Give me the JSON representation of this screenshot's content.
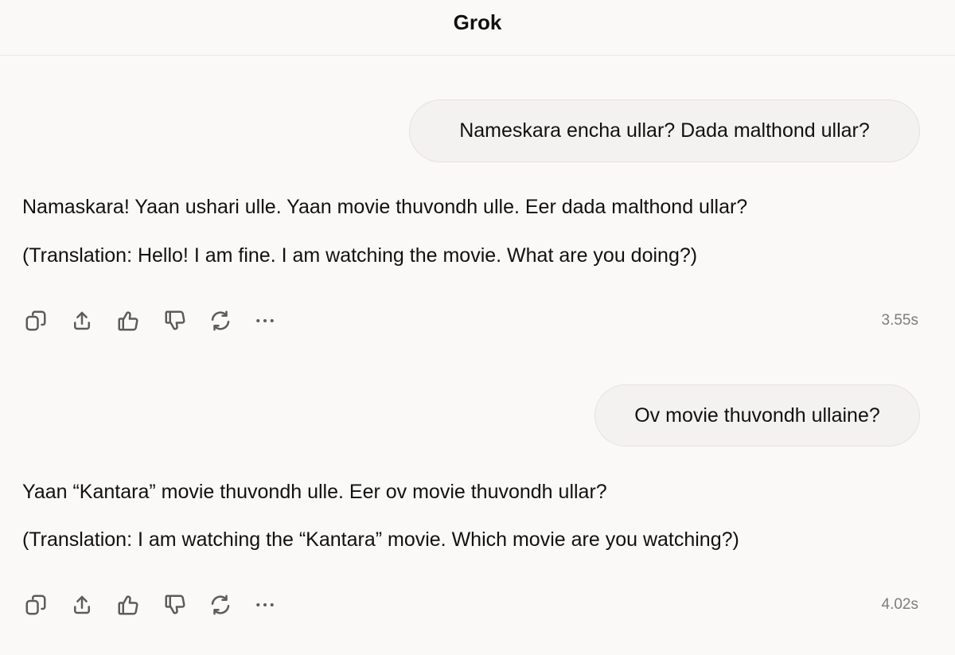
{
  "header": {
    "title": "Grok"
  },
  "conversation": [
    {
      "user_message": "Nameskara encha ullar? Dada malthond ullar?",
      "reply_lines": [
        "Namaskara! Yaan ushari ulle. Yaan movie thuvondh ulle. Eer dada malthond ullar?",
        "(Translation: Hello! I am fine. I am watching the movie. What are you doing?)"
      ],
      "response_time": "3.55s"
    },
    {
      "user_message": "Ov movie thuvondh ullaine?",
      "reply_lines": [
        "Yaan “Kantara” movie thuvondh ulle. Eer ov movie thuvondh ullar?",
        "(Translation: I am watching the “Kantara” movie. Which movie are you watching?)"
      ],
      "response_time": "4.02s"
    }
  ],
  "action_icons": [
    "copy-icon",
    "share-icon",
    "thumbs-up-icon",
    "thumbs-down-icon",
    "regenerate-icon",
    "more-icon"
  ]
}
